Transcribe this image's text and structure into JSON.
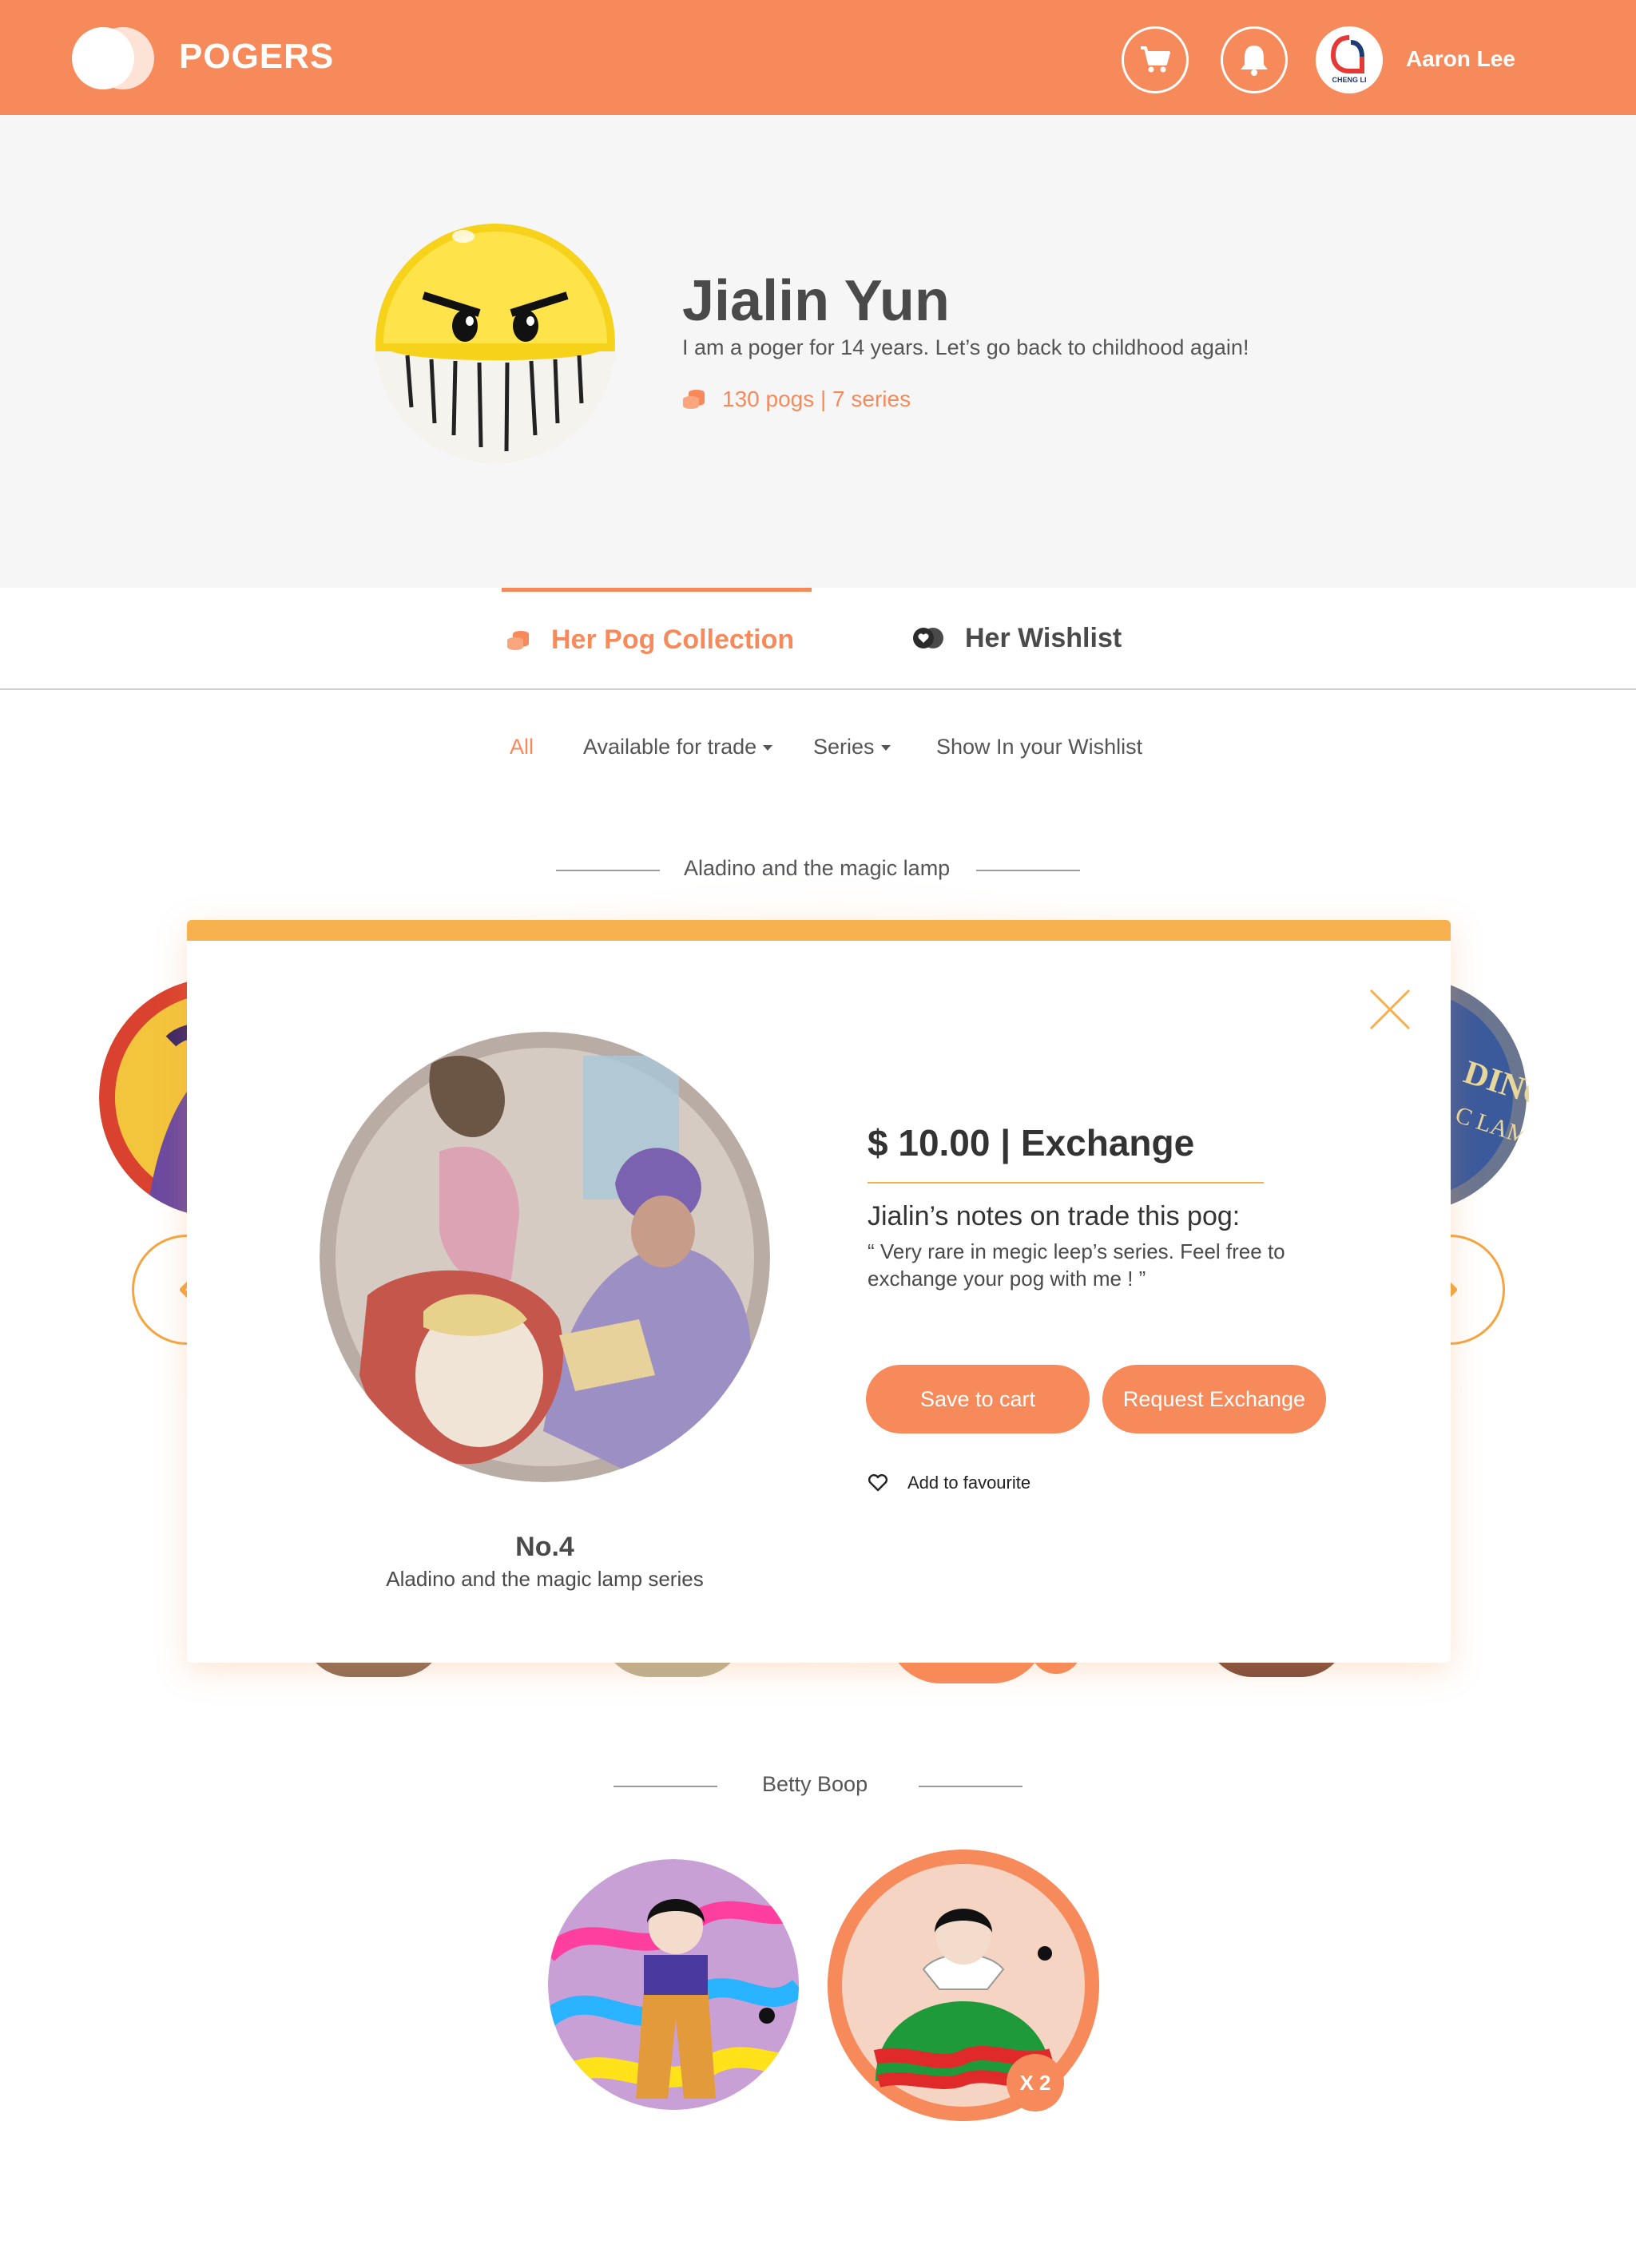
{
  "header": {
    "brand": "POGERS",
    "user_name": "Aaron Lee",
    "avatar_text": "CHENG LI"
  },
  "profile": {
    "name": "Jialin Yun",
    "bio": "I am a poger for 14 years. Let’s go back to childhood again!",
    "stats": "130 pogs | 7 series"
  },
  "tabs": [
    {
      "label": "Her Pog Collection",
      "active": true
    },
    {
      "label": "Her Wishlist",
      "active": false
    }
  ],
  "filters": {
    "all": "All",
    "available": "Available for trade",
    "series": "Series",
    "wishlist": "Show In your Wishlist"
  },
  "sections": {
    "aladdin": "Aladino and the magic lamp",
    "betty": "Betty Boop"
  },
  "modal": {
    "price": "$ 10.00 | Exchange",
    "notes_title": "Jialin’s notes on trade this pog:",
    "notes_body": "“ Very rare in megic leep’s series. Feel free to exchange your pog with me ! ”",
    "pog_number": "No.4",
    "pog_series": "Aladino and  the magic lamp series",
    "save_to_cart": "Save to cart",
    "request_exchange": "Request Exchange",
    "add_favourite": "Add to favourite"
  },
  "betty_boop": {
    "count_badge": "X 2"
  },
  "colors": {
    "brand_orange": "#f78a5b",
    "accent_yellow": "#f6b04e"
  },
  "icons": [
    "logo-icon",
    "cart-icon",
    "bell-icon",
    "coins-icon",
    "heart-badge-icon",
    "close-icon",
    "chevron-left-icon",
    "chevron-right-icon",
    "heart-outline-icon"
  ]
}
